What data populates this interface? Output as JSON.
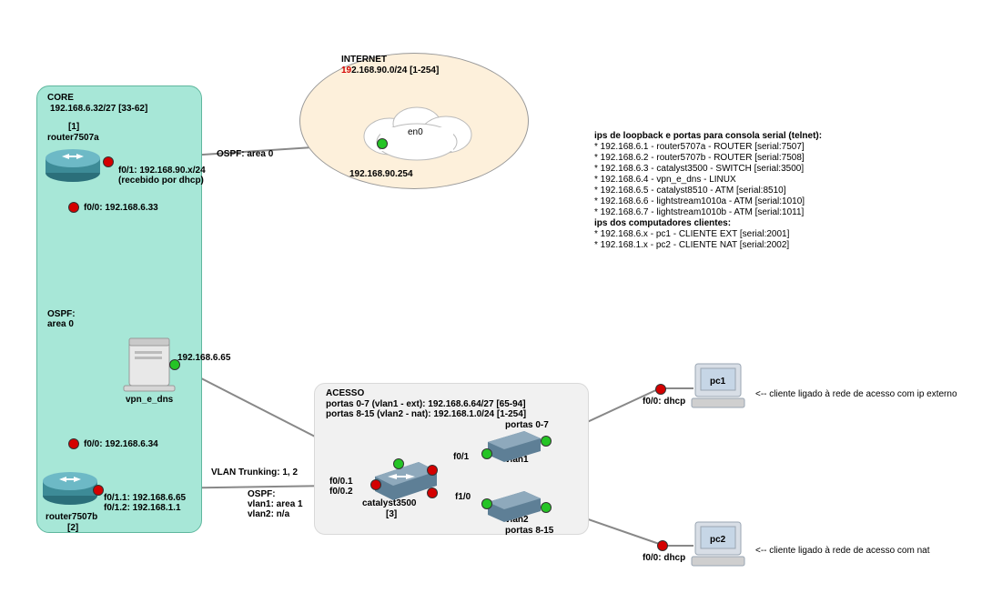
{
  "internet": {
    "title": "INTERNET",
    "subnet_pre": "19",
    "subnet_post": "2.168.90.0/24 [1-254]",
    "cloud_label": "en0",
    "gw_label": "192.168.90.254"
  },
  "core": {
    "title": "CORE",
    "subnet": "192.168.6.32/27 [33-62]",
    "r1_idx": "[1]",
    "r1_name": "router7507a",
    "r1_f01a": "f0/1: 192.168.90.x/24",
    "r1_f01b": "(recebido por dhcp)",
    "r1_f00": "f0/0: 192.168.6.33",
    "ospf_line": "OSPF:",
    "ospf_area": "area 0",
    "ospf_r1": "OSPF: area 0",
    "vpn_ip": "192.168.6.65",
    "vpn_name": "vpn_e_dns",
    "r2_f00": "f0/0: 192.168.6.34",
    "r2_name": "router7507b",
    "r2_idx": "[2]",
    "r2_sub1": "f0/1.1: 192.168.6.65",
    "r2_sub2": "f0/1.2: 192.168.1.1"
  },
  "trunk": {
    "label": "VLAN Trunking: 1, 2",
    "ospf_t": "OSPF:",
    "ospf_v1": "vlan1: area 1",
    "ospf_v2": "vlan2: n/a"
  },
  "acesso": {
    "title": "ACESSO",
    "line1": "portas 0-7 (vlan1 - ext): 192.168.6.64/27 [65-94]",
    "line2": "portas 8-15 (vlan2 - nat): 192.168.1.0/24 [1-254]",
    "sw_name": "catalyst3500",
    "sw_idx": "[3]",
    "f001": "f0/0.1",
    "f002": "f0/0.2",
    "f01": "f0/1",
    "f10": "f1/0",
    "vlan1": "vlan1",
    "vlan2": "vlan2",
    "p07": "portas 0-7",
    "p815": "portas 8-15"
  },
  "pc": {
    "pc1": "pc1",
    "pc2": "pc2",
    "pc1_if": "f0/0: dhcp",
    "pc2_if": "f0/0: dhcp",
    "pc1_desc": "<--  cliente ligado à rede de acesso com ip externo",
    "pc2_desc": "<--  cliente ligado à rede de acesso com nat"
  },
  "info": {
    "h1": "ips de loopback e portas para consola serial (telnet):",
    "l1": "* 192.168.6.1 - router5707a - ROUTER [serial:7507]",
    "l2": "* 192.168.6.2 - router5707b - ROUTER [serial:7508]",
    "l3": "* 192.168.6.3 - catalyst3500 - SWITCH [serial:3500]",
    "l4": "* 192.168.6.4 - vpn_e_dns - LINUX",
    "l5": "* 192.168.6.5 - catalyst8510 - ATM [serial:8510]",
    "l6": "* 192.168.6.6 - lightstream1010a - ATM [serial:1010]",
    "l7": "* 192.168.6.7 - lightstream1010b - ATM [serial:1011]",
    "h2": "ips dos computadores clientes:",
    "c1": "* 192.168.6.x - pc1 - CLIENTE EXT [serial:2001]",
    "c2": "* 192.168.1.x - pc2 - CLIENTE NAT [serial:2002]"
  }
}
